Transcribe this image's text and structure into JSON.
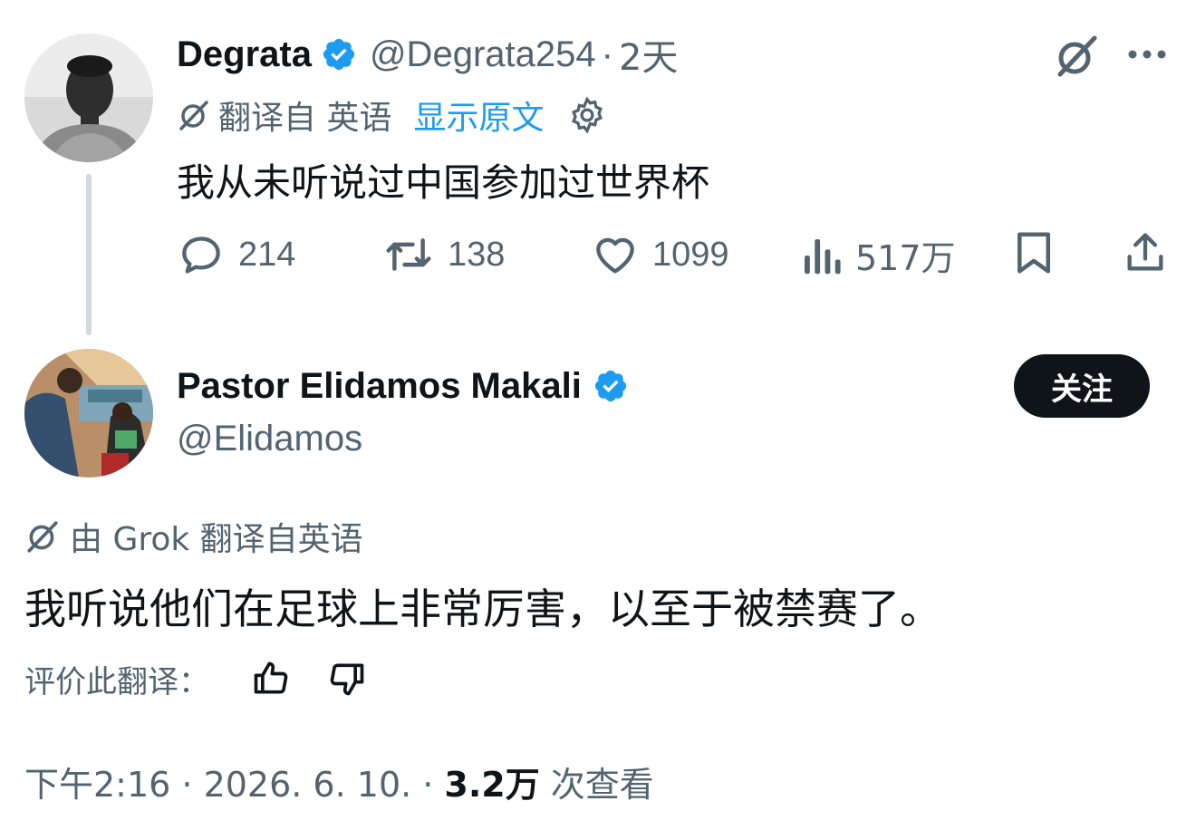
{
  "tweet1": {
    "author_name": "Degrata",
    "handle": "@Degrata254",
    "sep": "·",
    "time": "2天",
    "translated_from": "翻译自 英语",
    "show_original": "显示原文",
    "text": "我从未听说过中国参加过世界杯",
    "stats": {
      "replies": "214",
      "reposts": "138",
      "likes": "1099",
      "views": "517万"
    }
  },
  "tweet2": {
    "author_name": "Pastor Elidamos Makali",
    "handle": "@Elidamos",
    "follow_label": "关注",
    "grok_label": "由 Grok 翻译自英语",
    "text": "我听说他们在足球上非常厉害，以至于被禁赛了。",
    "rate_label": "评价此翻译：",
    "timestamp": "下午2:16 · 2026. 6. 10. ·",
    "views_count": "3.2万",
    "views_label": "次查看"
  },
  "colors": {
    "text": "#0f1419",
    "muted": "#536471",
    "link": "#1d9bf0",
    "verified": "#1d9bf0",
    "line": "#cfd9de"
  },
  "icons": [
    "grok-icon",
    "more-icon",
    "translate-icon",
    "gear-icon",
    "reply-icon",
    "repost-icon",
    "like-icon",
    "views-icon",
    "bookmark-icon",
    "share-icon",
    "verified-badge-icon",
    "thumbs-up-icon",
    "thumbs-down-icon"
  ]
}
